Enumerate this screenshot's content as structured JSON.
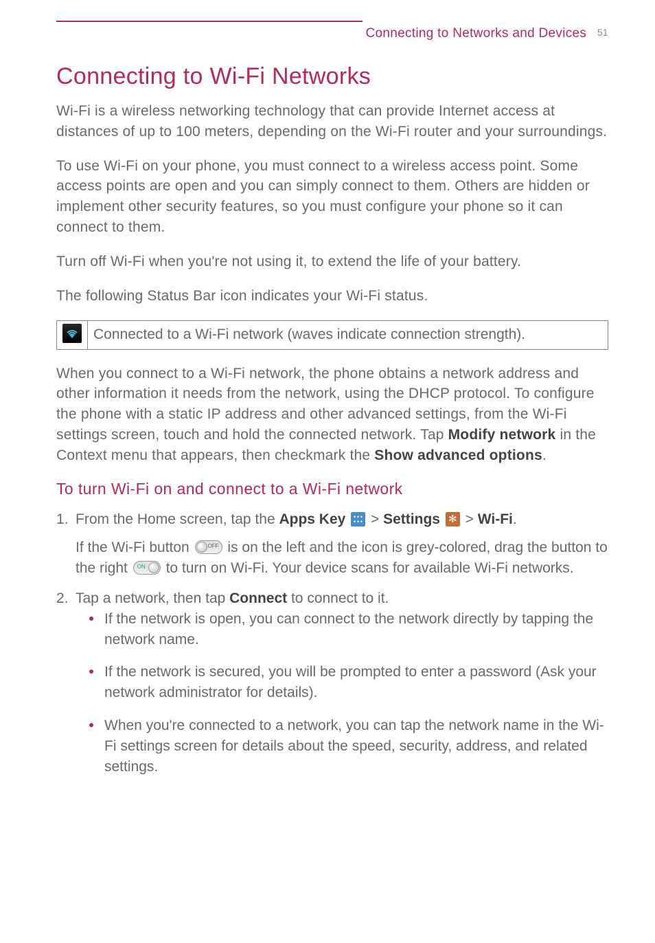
{
  "header": {
    "section": "Connecting to Networks and Devices",
    "page_number": "51"
  },
  "title": "Connecting to Wi-Fi Networks",
  "paragraphs": {
    "p1": "Wi-Fi is a wireless networking technology that can provide Internet access at distances of up to 100 meters, depending on the Wi-Fi router and your surroundings.",
    "p2": "To use Wi-Fi on your phone, you must connect to a wireless access point. Some access points are open and you can simply connect to them. Others are hidden or implement other security features, so you must configure your phone so it can connect to them.",
    "p3": "Turn off Wi-Fi when you're not using it, to extend the life of your battery.",
    "p4": "The following Status Bar icon indicates your Wi-Fi status."
  },
  "status_row": {
    "text": "Connected to a Wi-Fi network (waves indicate connection strength)."
  },
  "after_table": {
    "lead": "When you connect to a Wi-Fi network, the phone obtains a network address and other information it needs from the network, using the DHCP protocol. To configure the phone with a static IP address and other advanced settings, from the Wi-Fi settings screen, touch and hold the connected network. Tap ",
    "bold1": "Modify network",
    "mid": " in the Context menu that appears, then checkmark the ",
    "bold2": "Show advanced options",
    "tail": "."
  },
  "subheading": "To turn Wi-Fi on and connect to a Wi-Fi network",
  "steps": {
    "s1": {
      "pre": "From the Home screen, tap the ",
      "apps_key": "Apps Key",
      "sep1": " > ",
      "settings": "Settings",
      "sep2": " > ",
      "wifi": "Wi-Fi",
      "end": ".",
      "sub_pre": "If the Wi-Fi button ",
      "sub_mid1": " is on the left and the icon is grey-colored, drag the button to the right ",
      "sub_mid2": " to turn on Wi-Fi. Your device scans for available Wi-Fi networks."
    },
    "s2": {
      "pre": "Tap a network, then tap ",
      "connect": "Connect",
      "post": " to connect to it.",
      "b1": "If the network is open, you can connect to the network directly by tapping the network name.",
      "b2": "If the network is secured, you will be prompted to enter a password (Ask your network administrator for details).",
      "b3": "When you're connected to a network, you can tap the network name in the Wi-Fi settings screen for details about the speed, security, address, and related settings."
    }
  }
}
